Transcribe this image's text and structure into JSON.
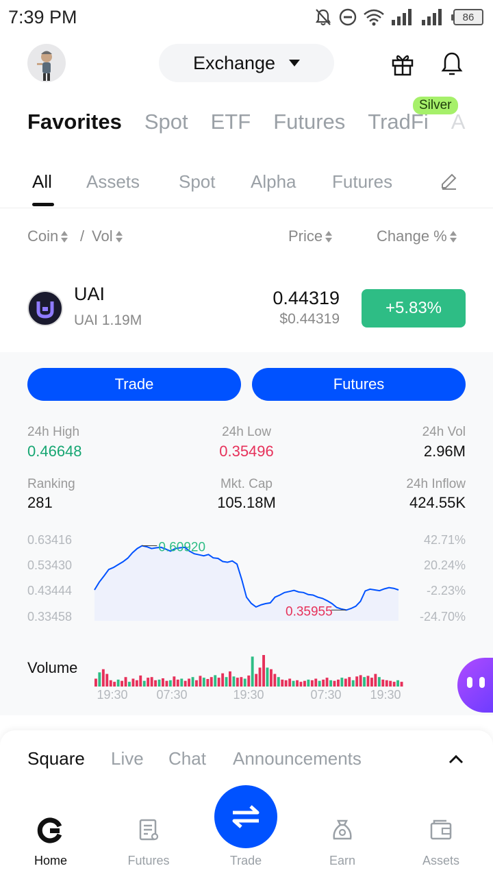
{
  "status_bar": {
    "time": "7:39 PM",
    "battery": "86"
  },
  "header": {
    "mode_label": "Exchange"
  },
  "main_tabs": [
    {
      "label": "Favorites"
    },
    {
      "label": "Spot"
    },
    {
      "label": "ETF"
    },
    {
      "label": "Futures"
    },
    {
      "label": "TradFi"
    },
    {
      "label": "A"
    }
  ],
  "tradfi_badge": "Silver",
  "sub_tabs": [
    {
      "label": "All"
    },
    {
      "label": "Assets"
    },
    {
      "label": "Spot"
    },
    {
      "label": "Alpha"
    },
    {
      "label": "Futures"
    }
  ],
  "columns": {
    "coin": "Coin",
    "separator": "/",
    "vol": "Vol",
    "price": "Price",
    "change": "Change %"
  },
  "coin": {
    "symbol": "UAI",
    "pair_label": "UAI",
    "volume": "1.19M",
    "price": "0.44319",
    "price_usd": "$0.44319",
    "change": "+5.83%"
  },
  "actions": {
    "trade": "Trade",
    "futures": "Futures"
  },
  "stats": {
    "high_label": "24h High",
    "high_value": "0.46648",
    "low_label": "24h Low",
    "low_value": "0.35496",
    "vol_label": "24h Vol",
    "vol_value": "2.96M",
    "rank_label": "Ranking",
    "rank_value": "281",
    "cap_label": "Mkt. Cap",
    "cap_value": "105.18M",
    "inflow_label": "24h Inflow",
    "inflow_value": "424.55K"
  },
  "chart_data": {
    "type": "line",
    "y_ticks_left": [
      "0.63416",
      "0.53430",
      "0.43444",
      "0.33458"
    ],
    "y_ticks_right": [
      "42.71%",
      "20.24%",
      "-2.23%",
      "-24.70%"
    ],
    "y_range": [
      0.33458,
      0.63416
    ],
    "x_ticks": [
      "19:30",
      "07:30",
      "19:30",
      "07:30",
      "19:30"
    ],
    "high_label": "0.60920",
    "low_label": "0.35955",
    "price_series": [
      0.438,
      0.468,
      0.492,
      0.517,
      0.525,
      0.536,
      0.547,
      0.561,
      0.582,
      0.598,
      0.609,
      0.605,
      0.598,
      0.601,
      0.603,
      0.596,
      0.588,
      0.598,
      0.601,
      0.603,
      0.588,
      0.578,
      0.574,
      0.57,
      0.575,
      0.562,
      0.56,
      0.548,
      0.545,
      0.55,
      0.538,
      0.478,
      0.41,
      0.386,
      0.372,
      0.38,
      0.385,
      0.388,
      0.41,
      0.418,
      0.428,
      0.432,
      0.436,
      0.43,
      0.428,
      0.42,
      0.418,
      0.41,
      0.405,
      0.396,
      0.385,
      0.37,
      0.364,
      0.36,
      0.366,
      0.375,
      0.394,
      0.434,
      0.441,
      0.438,
      0.435,
      0.442,
      0.447,
      0.444,
      0.438
    ],
    "volume_label": "Volume",
    "volume_bars": [
      {
        "v": 0.25,
        "up": false
      },
      {
        "v": 0.45,
        "up": true
      },
      {
        "v": 0.55,
        "up": false
      },
      {
        "v": 0.4,
        "up": false
      },
      {
        "v": 0.2,
        "up": false
      },
      {
        "v": 0.15,
        "up": false
      },
      {
        "v": 0.22,
        "up": true
      },
      {
        "v": 0.18,
        "up": false
      },
      {
        "v": 0.3,
        "up": false
      },
      {
        "v": 0.15,
        "up": true
      },
      {
        "v": 0.25,
        "up": false
      },
      {
        "v": 0.2,
        "up": false
      },
      {
        "v": 0.35,
        "up": false
      },
      {
        "v": 0.18,
        "up": true
      },
      {
        "v": 0.28,
        "up": false
      },
      {
        "v": 0.3,
        "up": false
      },
      {
        "v": 0.2,
        "up": false
      },
      {
        "v": 0.22,
        "up": true
      },
      {
        "v": 0.26,
        "up": false
      },
      {
        "v": 0.18,
        "up": false
      },
      {
        "v": 0.2,
        "up": true
      },
      {
        "v": 0.32,
        "up": false
      },
      {
        "v": 0.22,
        "up": false
      },
      {
        "v": 0.25,
        "up": true
      },
      {
        "v": 0.18,
        "up": false
      },
      {
        "v": 0.25,
        "up": false
      },
      {
        "v": 0.3,
        "up": true
      },
      {
        "v": 0.2,
        "up": false
      },
      {
        "v": 0.34,
        "up": false
      },
      {
        "v": 0.28,
        "up": true
      },
      {
        "v": 0.24,
        "up": false
      },
      {
        "v": 0.3,
        "up": false
      },
      {
        "v": 0.36,
        "up": true
      },
      {
        "v": 0.28,
        "up": false
      },
      {
        "v": 0.42,
        "up": false
      },
      {
        "v": 0.3,
        "up": true
      },
      {
        "v": 0.48,
        "up": false
      },
      {
        "v": 0.32,
        "up": true
      },
      {
        "v": 0.28,
        "up": false
      },
      {
        "v": 0.3,
        "up": false
      },
      {
        "v": 0.25,
        "up": true
      },
      {
        "v": 0.35,
        "up": false
      },
      {
        "v": 0.95,
        "up": true
      },
      {
        "v": 0.4,
        "up": false
      },
      {
        "v": 0.6,
        "up": false
      },
      {
        "v": 1.0,
        "up": false
      },
      {
        "v": 0.6,
        "up": true
      },
      {
        "v": 0.55,
        "up": false
      },
      {
        "v": 0.4,
        "up": false
      },
      {
        "v": 0.3,
        "up": true
      },
      {
        "v": 0.22,
        "up": false
      },
      {
        "v": 0.2,
        "up": false
      },
      {
        "v": 0.25,
        "up": false
      },
      {
        "v": 0.18,
        "up": true
      },
      {
        "v": 0.2,
        "up": false
      },
      {
        "v": 0.15,
        "up": false
      },
      {
        "v": 0.18,
        "up": false
      },
      {
        "v": 0.22,
        "up": true
      },
      {
        "v": 0.2,
        "up": false
      },
      {
        "v": 0.25,
        "up": false
      },
      {
        "v": 0.18,
        "up": true
      },
      {
        "v": 0.22,
        "up": false
      },
      {
        "v": 0.28,
        "up": false
      },
      {
        "v": 0.2,
        "up": true
      },
      {
        "v": 0.18,
        "up": false
      },
      {
        "v": 0.22,
        "up": false
      },
      {
        "v": 0.28,
        "up": true
      },
      {
        "v": 0.25,
        "up": false
      },
      {
        "v": 0.3,
        "up": false
      },
      {
        "v": 0.2,
        "up": true
      },
      {
        "v": 0.32,
        "up": false
      },
      {
        "v": 0.36,
        "up": false
      },
      {
        "v": 0.3,
        "up": true
      },
      {
        "v": 0.34,
        "up": false
      },
      {
        "v": 0.28,
        "up": false
      },
      {
        "v": 0.4,
        "up": false
      },
      {
        "v": 0.3,
        "up": true
      },
      {
        "v": 0.22,
        "up": false
      },
      {
        "v": 0.2,
        "up": false
      },
      {
        "v": 0.18,
        "up": false
      },
      {
        "v": 0.15,
        "up": false
      },
      {
        "v": 0.2,
        "up": true
      },
      {
        "v": 0.15,
        "up": false
      }
    ]
  },
  "square_tabs": [
    {
      "label": "Square"
    },
    {
      "label": "Live"
    },
    {
      "label": "Chat"
    },
    {
      "label": "Announcements"
    }
  ],
  "bottom_nav": {
    "home": "Home",
    "futures": "Futures",
    "trade": "Trade",
    "earn": "Earn",
    "assets": "Assets"
  },
  "colors": {
    "brand": "#0052ff",
    "up": "#2ebd85",
    "down": "#e6315a"
  }
}
